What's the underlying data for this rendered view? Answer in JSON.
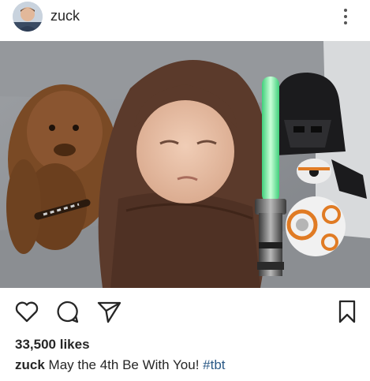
{
  "post": {
    "username": "zuck",
    "likes": "33,500 likes",
    "caption": {
      "user": "zuck",
      "text": "May the 4th Be With You!",
      "hashtag": "#tbt"
    },
    "icons": {
      "more": "more-vertical-icon",
      "like": "heart-outline-icon",
      "comment": "comment-bubble-icon",
      "share": "paper-plane-icon",
      "save": "bookmark-icon"
    },
    "colors": {
      "hashtag": "#2b5a87",
      "text": "#262626"
    }
  }
}
